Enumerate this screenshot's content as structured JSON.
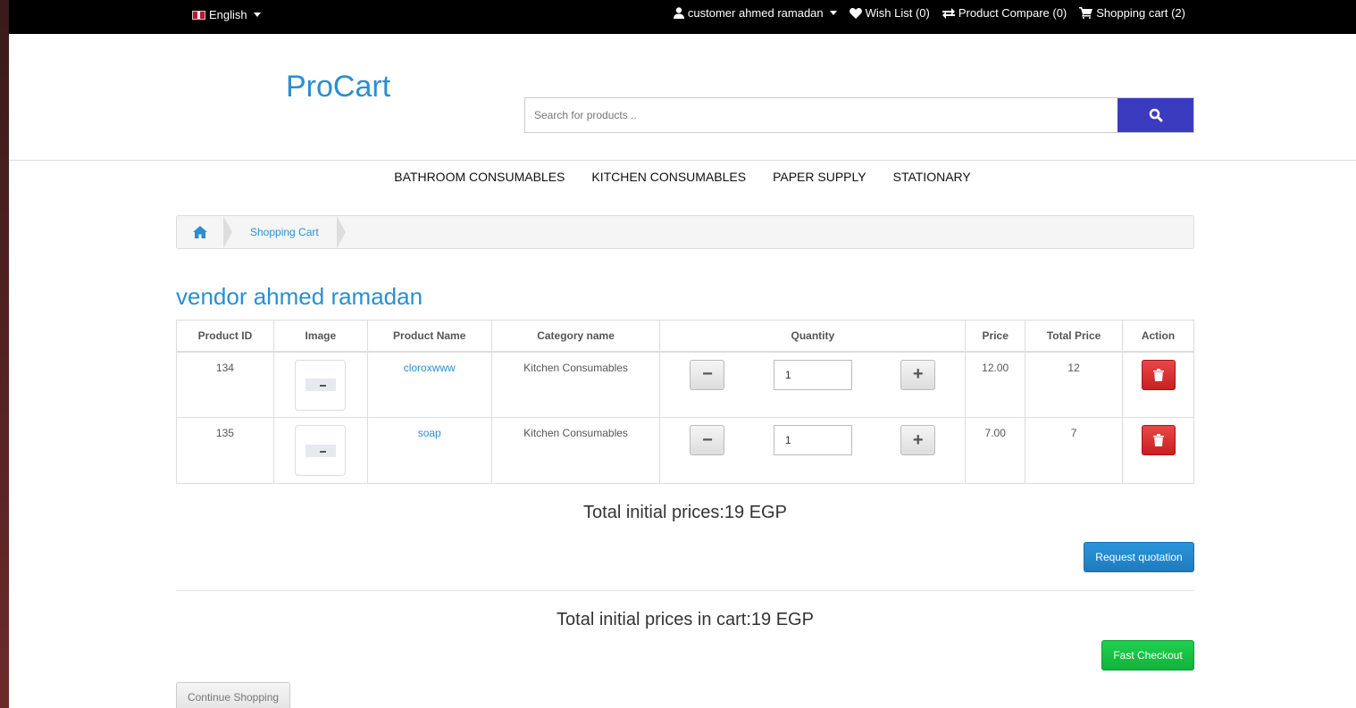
{
  "topbar": {
    "language": "English",
    "account": "customer ahmed ramadan",
    "wishlist": "Wish List (0)",
    "compare": "Product Compare (0)",
    "cart": "Shopping cart (2)"
  },
  "header": {
    "logo": "ProCart",
    "search_placeholder": "Search for products .."
  },
  "nav": [
    "BATHROOM CONSUMABLES",
    "KITCHEN CONSUMABLES",
    "PAPER SUPPLY",
    "STATIONARY"
  ],
  "breadcrumb": {
    "current": "Shopping Cart"
  },
  "vendor": "vendor ahmed ramadan",
  "table": {
    "headers": [
      "Product ID",
      "Image",
      "Product Name",
      "Category name",
      "Quantity",
      "Price",
      "Total Price",
      "Action"
    ],
    "rows": [
      {
        "id": "134",
        "name": "cloroxwww",
        "category": "Kitchen Consumables",
        "qty": "1",
        "price": "12.00",
        "total": "12"
      },
      {
        "id": "135",
        "name": "soap",
        "category": "Kitchen Consumables",
        "qty": "1",
        "price": "7.00",
        "total": "7"
      }
    ]
  },
  "totals": {
    "vendor_total": "Total initial prices:19 EGP",
    "cart_total": "Total initial prices in cart:19 EGP"
  },
  "buttons": {
    "request_quotation": "Request quotation",
    "fast_checkout": "Fast Checkout",
    "continue_shopping": "Continue Shopping"
  },
  "colors": {
    "accent": "#2a8fd0",
    "search_button": "#3b3bbf",
    "danger": "#d9282a",
    "success": "#17c244"
  }
}
